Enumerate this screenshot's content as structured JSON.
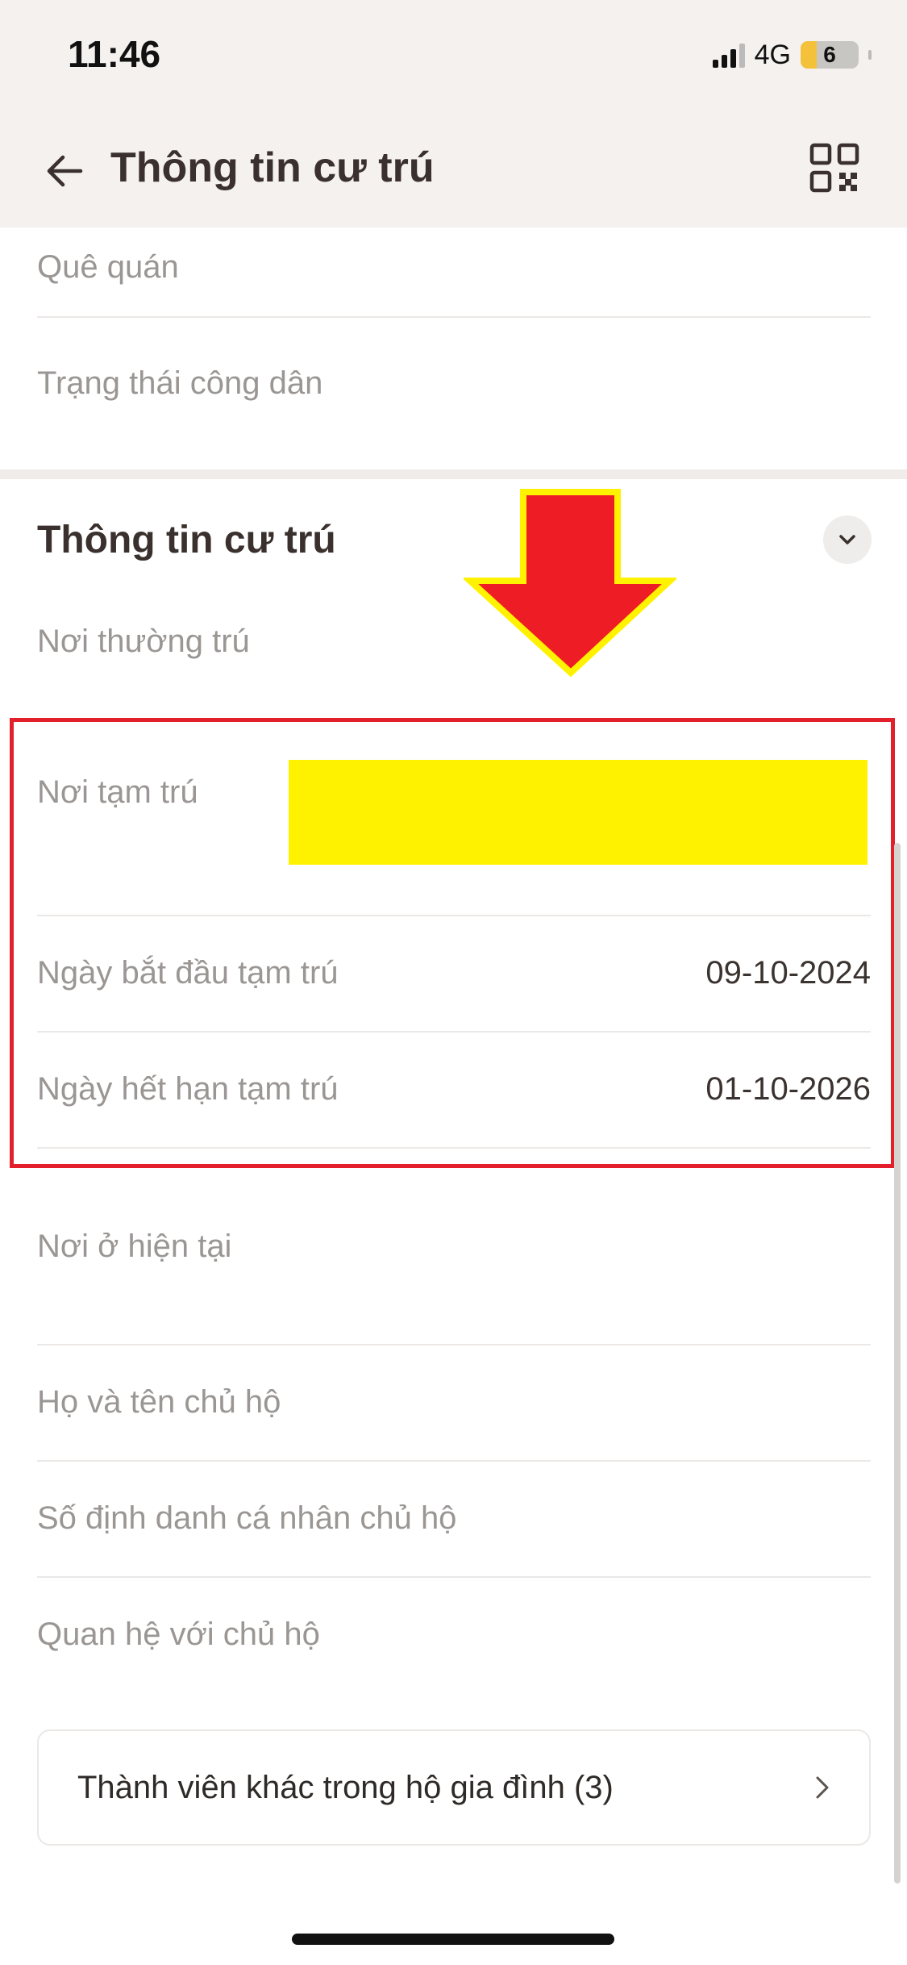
{
  "status_bar": {
    "time": "11:46",
    "network": "4G",
    "battery": "6"
  },
  "header": {
    "title": "Thông tin cư trú",
    "back_icon": "arrow-left-icon",
    "qr_icon": "qr-code-icon"
  },
  "citizen_rows": [
    {
      "label": "Quê quán",
      "value": ""
    },
    {
      "label": "Trạng thái công dân",
      "value": ""
    }
  ],
  "residence_section": {
    "title": "Thông tin cư trú",
    "collapse_icon": "chevron-down-icon",
    "rows": [
      {
        "label": "Nơi thường trú",
        "value": ""
      },
      {
        "label": "Nơi tạm trú",
        "value": ""
      },
      {
        "label": "Ngày bắt đầu tạm trú",
        "value": "09-10-2024"
      },
      {
        "label": "Ngày hết hạn tạm trú",
        "value": "01-10-2026"
      },
      {
        "label": "Nơi ở hiện tại",
        "value": ""
      },
      {
        "label": "Họ và tên chủ hộ",
        "value": ""
      },
      {
        "label": "Số định danh cá nhân chủ hộ",
        "value": ""
      },
      {
        "label": "Quan hệ với chủ hộ",
        "value": ""
      }
    ]
  },
  "family_card": {
    "label": "Thành viên khác trong hộ gia đình (3)",
    "icon": "chevron-right-icon"
  },
  "annotations": {
    "highlight_color": "#e31f2b",
    "arrow_color": "#ee1c25",
    "redaction_color": "#fff200"
  }
}
